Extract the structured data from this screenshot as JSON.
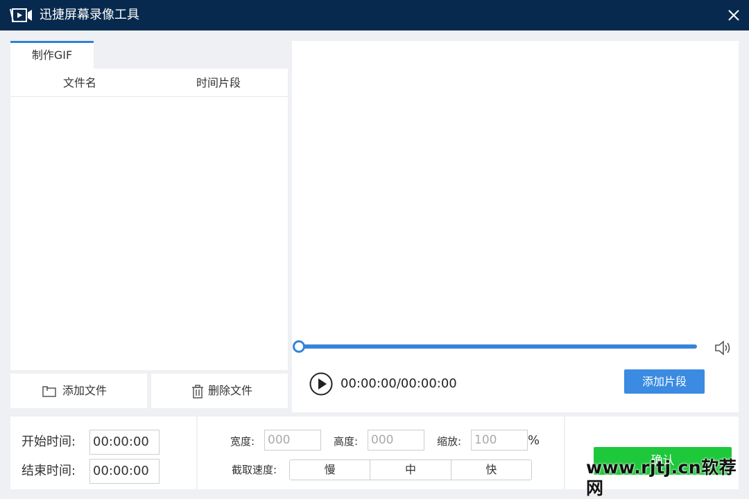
{
  "window": {
    "title": "迅捷屏幕录像工具"
  },
  "left_panel": {
    "tab_label": "制作GIF",
    "columns": [
      "文件名",
      "时间片段"
    ],
    "add_file_label": "添加文件",
    "delete_file_label": "删除文件"
  },
  "player": {
    "timecode": "00:00:00/00:00:00",
    "progress": 0,
    "add_segment_label": "添加片段"
  },
  "time_settings": {
    "start_label": "开始时间:",
    "start_value": "00:00:00",
    "end_label": "结束时间:",
    "end_value": "00:00:00"
  },
  "params": {
    "width_label": "宽度:",
    "width_value": "000",
    "height_label": "高度:",
    "height_value": "000",
    "scale_label": "缩放:",
    "scale_value": "100",
    "scale_unit": "%",
    "speed_label": "截取速度:",
    "speeds": [
      "慢",
      "中",
      "快"
    ]
  },
  "confirm_label": "确认",
  "watermark": "www.rjtj.cn软荐网",
  "colors": {
    "titlebar": "#07294d",
    "accent": "#3584d9",
    "confirm": "#1dc83a"
  }
}
